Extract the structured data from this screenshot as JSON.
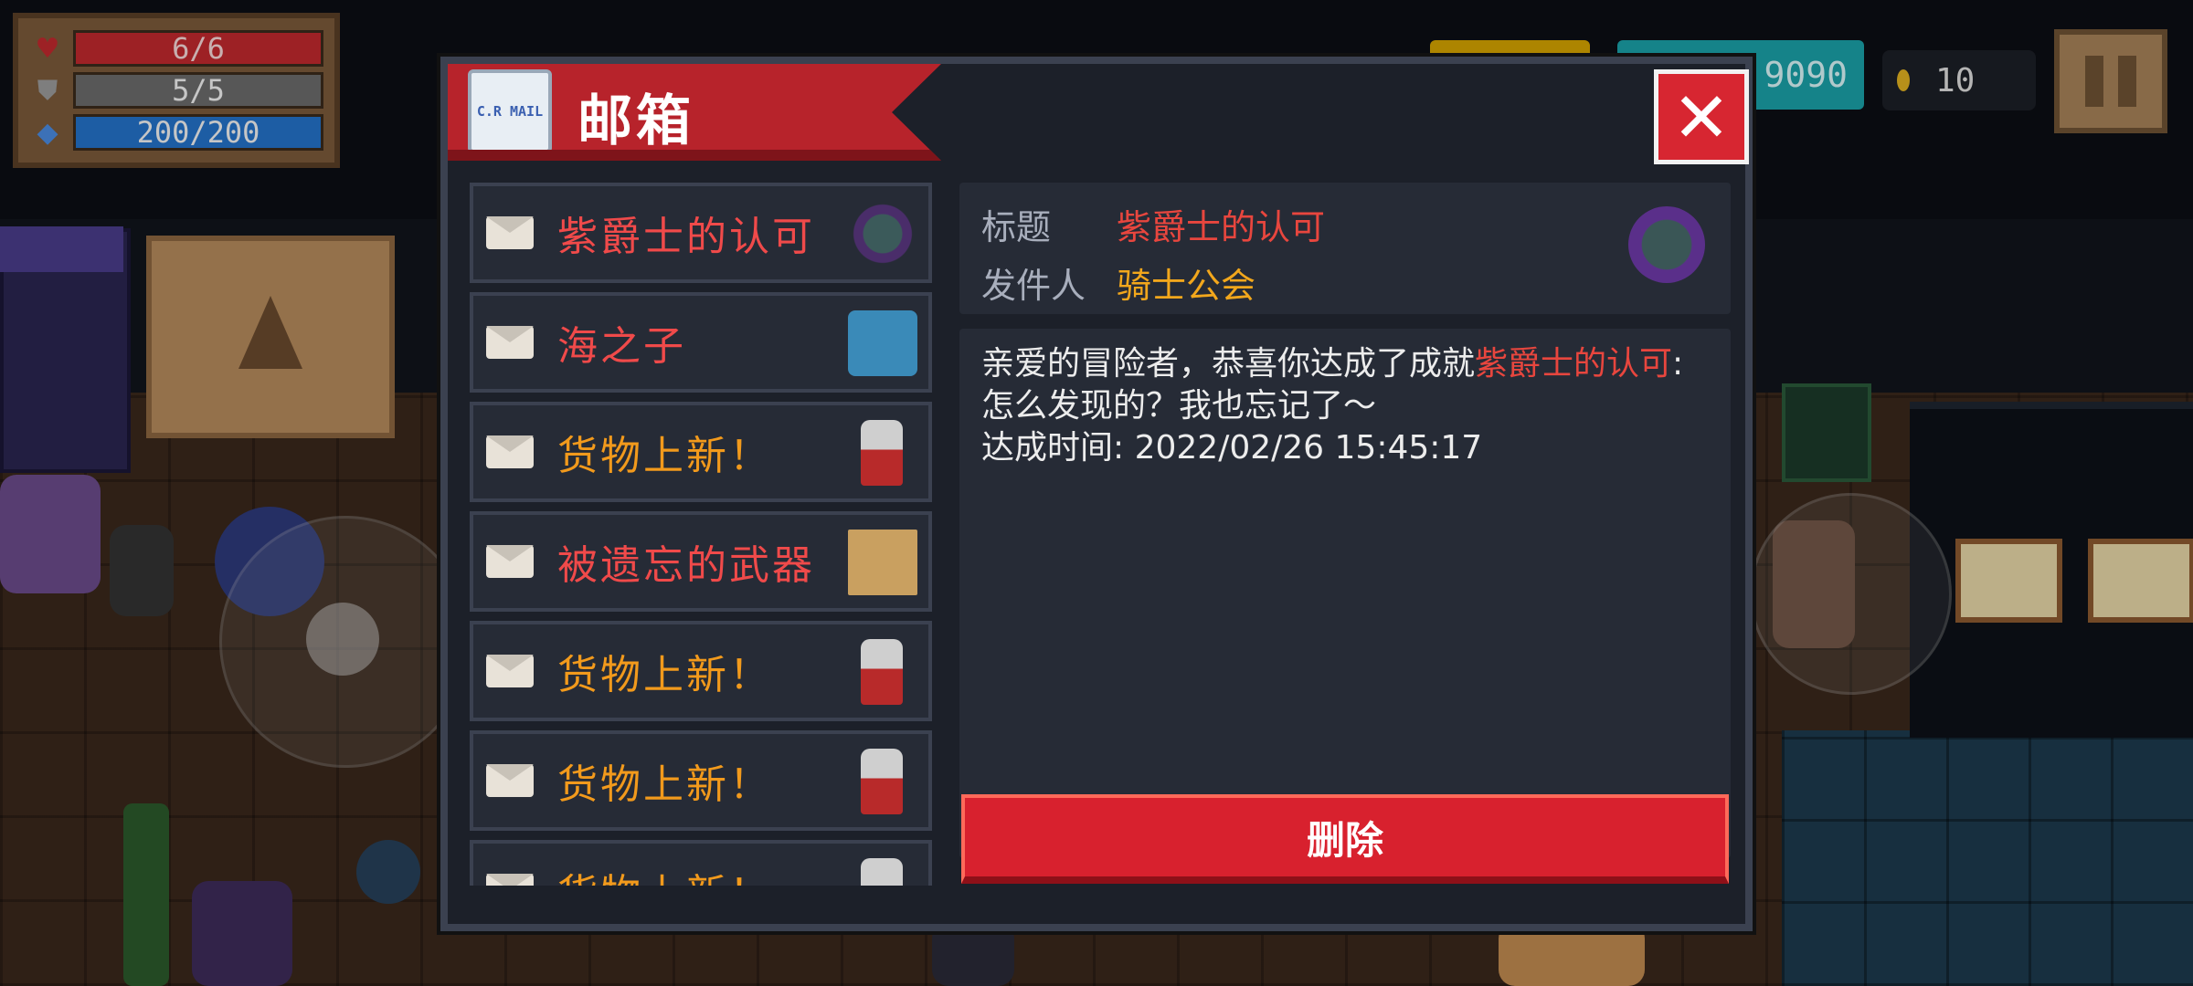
{
  "hud": {
    "hp": "6/6",
    "armor": "5/5",
    "energy": "200/200",
    "gems_partial": "9090",
    "coins": "10"
  },
  "mailbox": {
    "title": "邮箱",
    "mail_icon_text": "C.R MAIL",
    "close_label": "✕",
    "list": [
      {
        "title": "紫爵士的认可",
        "color": "red",
        "thumb": "knight-icon"
      },
      {
        "title": "海之子",
        "color": "red",
        "thumb": "sea-child-icon"
      },
      {
        "title": "货物上新！",
        "color": "orange",
        "thumb": "merchant-icon"
      },
      {
        "title": "被遗忘的武器",
        "color": "red",
        "thumb": "weapon-map-icon"
      },
      {
        "title": "货物上新！",
        "color": "orange",
        "thumb": "merchant-icon"
      },
      {
        "title": "货物上新！",
        "color": "orange",
        "thumb": "merchant-icon"
      },
      {
        "title": "货物上新！",
        "color": "orange",
        "thumb": "merchant-icon"
      }
    ],
    "detail": {
      "title_label": "标题",
      "title_value": "紫爵士的认可",
      "sender_label": "发件人",
      "sender_value": "骑士公会",
      "body_prefix": "亲爱的冒险者，恭喜你达成了成就",
      "body_highlight": "紫爵士的认可",
      "body_suffix": ":怎么发现的？我也忘记了～",
      "achieved_line": "达成时间: 2022/02/26 15:45:17"
    },
    "delete_label": "删除"
  },
  "colors": {
    "accent_red": "#d8212e",
    "highlight_red": "#e8463e",
    "highlight_orange": "#f2a71c"
  }
}
